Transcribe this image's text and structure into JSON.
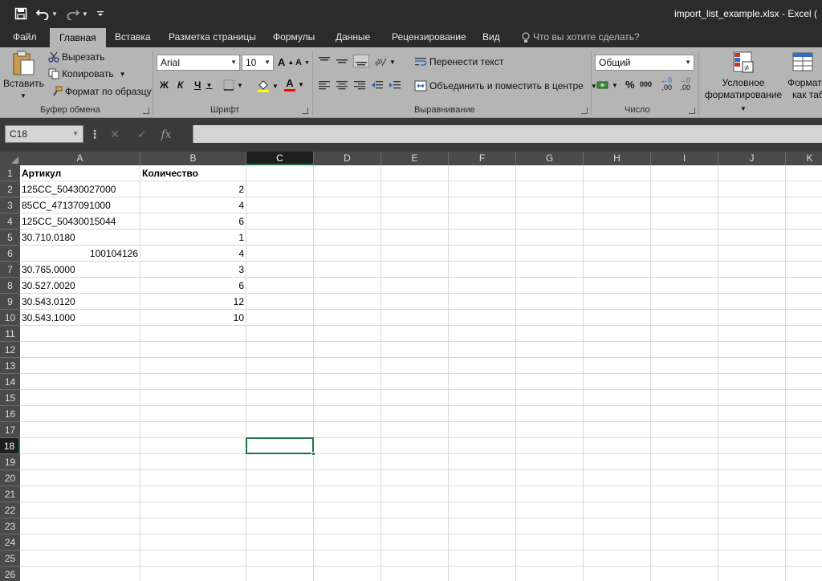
{
  "window": {
    "title": "import_list_example.xlsx - Excel ("
  },
  "ribbon_tabs": [
    {
      "label": "Файл"
    },
    {
      "label": "Главная"
    },
    {
      "label": "Вставка"
    },
    {
      "label": "Разметка страницы"
    },
    {
      "label": "Формулы"
    },
    {
      "label": "Данные"
    },
    {
      "label": "Рецензирование"
    },
    {
      "label": "Вид"
    }
  ],
  "tell_me": "Что вы хотите сделать?",
  "clipboard": {
    "paste": "Вставить",
    "cut": "Вырезать",
    "copy": "Копировать",
    "format_painter": "Формат по образцу",
    "group_label": "Буфер обмена"
  },
  "font": {
    "name": "Arial",
    "size": "10",
    "bold": "Ж",
    "italic": "К",
    "underline": "Ч",
    "grow": "A",
    "shrink": "A",
    "color_letter": "A",
    "group_label": "Шрифт"
  },
  "alignment": {
    "wrap_text": "Перенести текст",
    "merge_center": "Объединить и поместить в центре",
    "group_label": "Выравнивание"
  },
  "number": {
    "format": "Общий",
    "percent": "%",
    "thousands": "000",
    "inc_decimal": ",00",
    "dec_decimal": ",00",
    "group_label": "Число"
  },
  "styles": {
    "conditional_line1": "Условное",
    "conditional_line2": "форматирование",
    "format_table_line1": "Формат",
    "format_table_line2": "как таб"
  },
  "formula_bar": {
    "name_box": "C18",
    "fx": "fx",
    "content": ""
  },
  "sheet": {
    "columns": [
      "A",
      "B",
      "C",
      "D",
      "E",
      "F",
      "G",
      "H",
      "I",
      "J",
      "K"
    ],
    "selected_column": "C",
    "selected_row": 18,
    "rows": [
      {
        "row": "1",
        "a": "Артикул",
        "b": "Количество"
      },
      {
        "row": "2",
        "a": "125CC_50430027000",
        "b": "2"
      },
      {
        "row": "3",
        "a": "85CC_47137091000",
        "b": "4"
      },
      {
        "row": "4",
        "a": "125CC_50430015044",
        "b": "6"
      },
      {
        "row": "5",
        "a": "30.710.0180",
        "b": "1"
      },
      {
        "row": "6",
        "a": "100104126",
        "b": "4"
      },
      {
        "row": "7",
        "a": "30.765.0000",
        "b": "3"
      },
      {
        "row": "8",
        "a": "30.527.0020",
        "b": "6"
      },
      {
        "row": "9",
        "a": "30.543.0120",
        "b": "12"
      },
      {
        "row": "10",
        "a": "30.543.1000",
        "b": "10"
      },
      {
        "row": "11",
        "a": "",
        "b": ""
      },
      {
        "row": "12",
        "a": "",
        "b": ""
      },
      {
        "row": "13",
        "a": "",
        "b": ""
      },
      {
        "row": "14",
        "a": "",
        "b": ""
      },
      {
        "row": "15",
        "a": "",
        "b": ""
      },
      {
        "row": "16",
        "a": "",
        "b": ""
      },
      {
        "row": "17",
        "a": "",
        "b": ""
      },
      {
        "row": "18",
        "a": "",
        "b": ""
      },
      {
        "row": "19",
        "a": "",
        "b": ""
      },
      {
        "row": "20",
        "a": "",
        "b": ""
      },
      {
        "row": "21",
        "a": "",
        "b": ""
      },
      {
        "row": "22",
        "a": "",
        "b": ""
      },
      {
        "row": "23",
        "a": "",
        "b": ""
      },
      {
        "row": "24",
        "a": "",
        "b": ""
      },
      {
        "row": "25",
        "a": "",
        "b": ""
      },
      {
        "row": "26",
        "a": "",
        "b": ""
      }
    ]
  },
  "colors": {
    "title_bar": "#2b2b2b",
    "ribbon": "#b5b5b5",
    "header": "#4a4a4a",
    "accent": "#217346",
    "gridline": "#d9d9d9"
  }
}
